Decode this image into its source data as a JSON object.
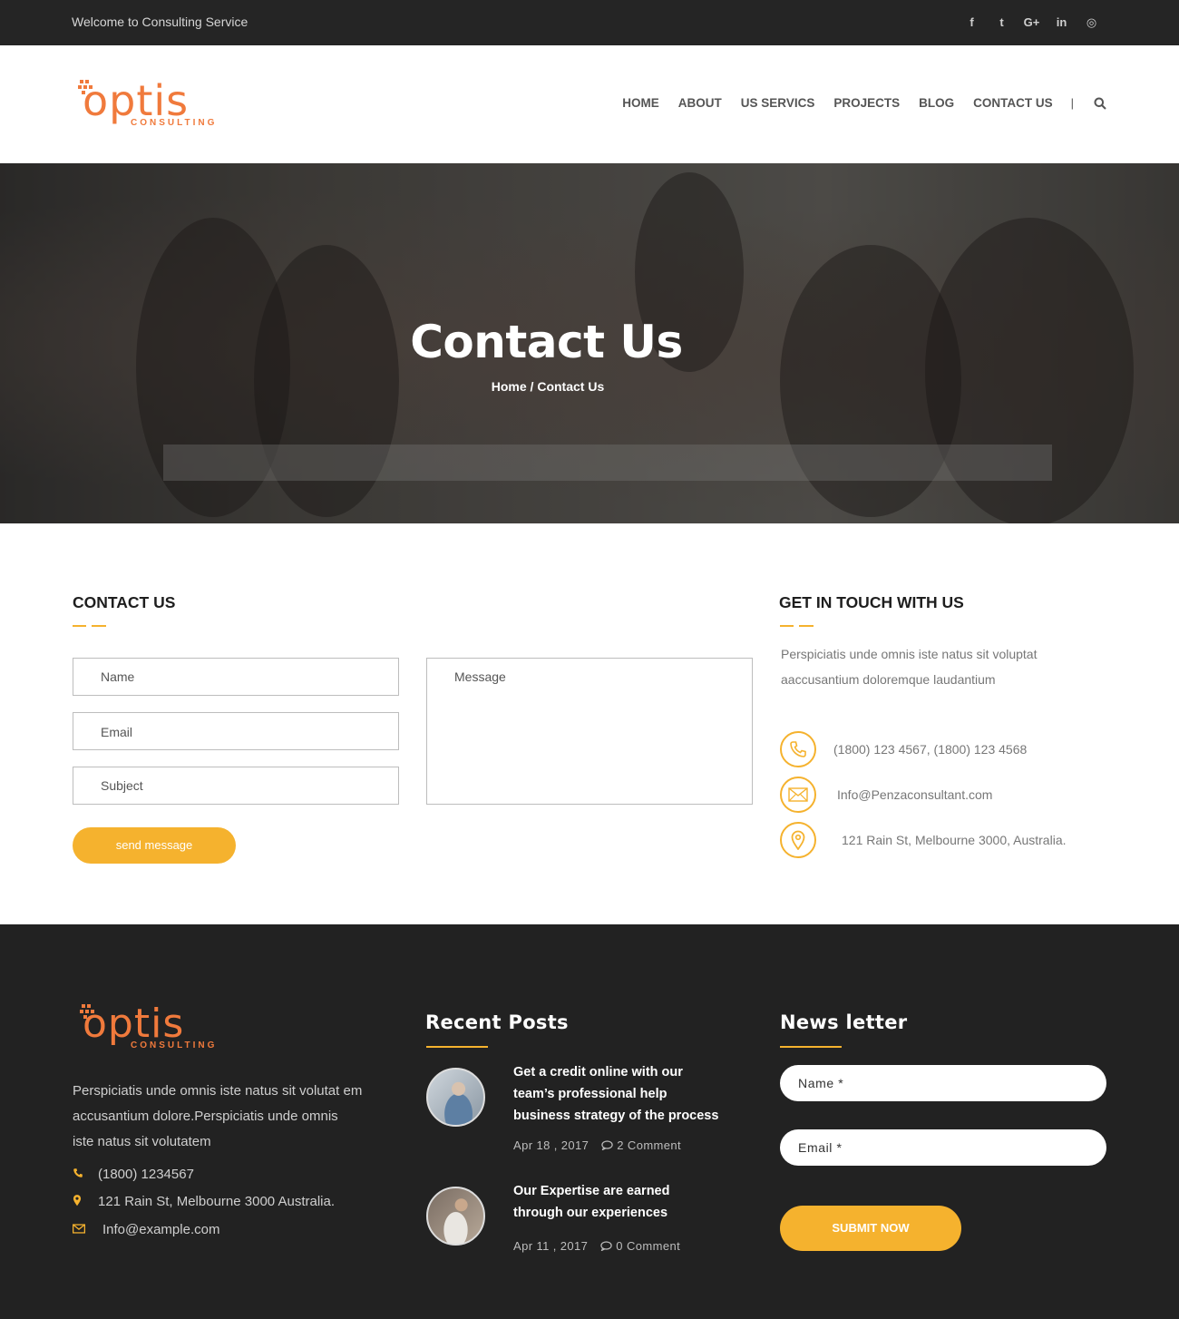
{
  "topbar": {
    "welcome": "Welcome to Consulting Service",
    "social": [
      "facebook-icon",
      "twitter-icon",
      "google-plus-icon",
      "linkedin-icon",
      "instagram-icon"
    ],
    "social_glyphs": [
      "f",
      "t",
      "G+",
      "in",
      "◎"
    ]
  },
  "brand": {
    "name": "OPTIS",
    "tagline": "CONSULTING",
    "accent": "#f07a3c"
  },
  "nav": {
    "items": [
      "HOME",
      "ABOUT",
      "US SERVICS",
      "PROJECTS",
      "BLOG",
      "CONTACT US"
    ],
    "separator": "|"
  },
  "hero": {
    "title": "Contact Us",
    "breadcrumb": "Home / Contact Us"
  },
  "contact_form": {
    "title": "CONTACT US",
    "name_placeholder": "Name",
    "email_placeholder": "Email",
    "subject_placeholder": "Subject",
    "message_placeholder": "Message",
    "send_label": "send message"
  },
  "get_in_touch": {
    "title": "GET IN TOUCH WITH US",
    "text": "Perspiciatis unde omnis iste natus sit voluptat aaccusantium doloremque laudantium",
    "phone": "(1800) 123 4567, (1800) 123 4568",
    "email": "Info@Penzaconsultant.com",
    "address": "121 Rain St, Melbourne 3000, Australia."
  },
  "footer": {
    "description": "Perspiciatis unde omnis iste natus sit volutat em accusantium dolore.Perspiciatis unde omnis iste natus sit volutatem",
    "phone": "(1800) 1234567",
    "address": "121 Rain St, Melbourne 3000 Australia.",
    "email": "Info@example.com",
    "recent_posts_title": "Recent Posts",
    "posts": [
      {
        "title": "Get a credit online with our team’s professional help business strategy of the process",
        "date": "Apr 18 , 2017",
        "comments": "2 Comment"
      },
      {
        "title": "Our Expertise are earned through our experiences",
        "date": "Apr 11 , 2017",
        "comments": "0 Comment"
      }
    ],
    "newsletter_title": "News letter",
    "nl_name_placeholder": "Name *",
    "nl_email_placeholder": "Email *",
    "submit_label": "SUBMIT NOW"
  },
  "colors": {
    "accent": "#f5b22e",
    "dark": "#222222",
    "topbar": "#252525"
  }
}
